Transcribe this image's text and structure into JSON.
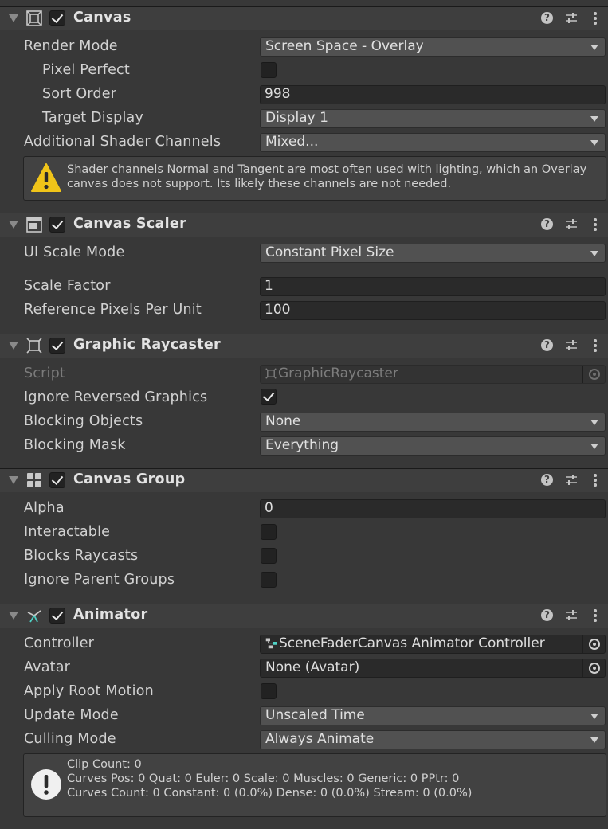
{
  "canvas": {
    "title": "Canvas",
    "enabled": true,
    "render_mode_label": "Render Mode",
    "render_mode_value": "Screen Space - Overlay",
    "pixel_perfect_label": "Pixel Perfect",
    "sort_order_label": "Sort Order",
    "sort_order_value": "998",
    "target_display_label": "Target Display",
    "target_display_value": "Display 1",
    "shader_channels_label": "Additional Shader Channels",
    "shader_channels_value": "Mixed...",
    "warning_line1": "Shader channels Normal and Tangent are most often used with lighting, which an Overlay",
    "warning_line2": "canvas does not support. Its likely these channels are not needed."
  },
  "canvas_scaler": {
    "title": "Canvas Scaler",
    "ui_scale_mode_label": "UI Scale Mode",
    "ui_scale_mode_value": "Constant Pixel Size",
    "scale_factor_label": "Scale Factor",
    "scale_factor_value": "1",
    "ref_ppu_label": "Reference Pixels Per Unit",
    "ref_ppu_value": "100"
  },
  "graphic_raycaster": {
    "title": "Graphic Raycaster",
    "script_label": "Script",
    "script_value": "GraphicRaycaster",
    "ignore_reversed_label": "Ignore Reversed Graphics",
    "blocking_objects_label": "Blocking Objects",
    "blocking_objects_value": "None",
    "blocking_mask_label": "Blocking Mask",
    "blocking_mask_value": "Everything"
  },
  "canvas_group": {
    "title": "Canvas Group",
    "alpha_label": "Alpha",
    "alpha_value": "0",
    "interactable_label": "Interactable",
    "blocks_raycasts_label": "Blocks Raycasts",
    "ignore_parent_label": "Ignore Parent Groups"
  },
  "animator": {
    "title": "Animator",
    "controller_label": "Controller",
    "controller_value": "SceneFaderCanvas Animator Controller",
    "avatar_label": "Avatar",
    "avatar_value": "None (Avatar)",
    "apply_root_motion_label": "Apply Root Motion",
    "update_mode_label": "Update Mode",
    "update_mode_value": "Unscaled Time",
    "culling_mode_label": "Culling Mode",
    "culling_mode_value": "Always Animate",
    "info_line1": "Clip Count: 0",
    "info_line2": "Curves Pos: 0 Quat: 0 Euler: 0 Scale: 0 Muscles: 0 Generic: 0 PPtr: 0",
    "info_line3": "Curves Count: 0 Constant: 0 (0.0%) Dense: 0 (0.0%) Stream: 0 (0.0%)"
  },
  "icons": {
    "help": "?",
    "colors": {
      "warning": "#f0c419",
      "info": "#f0f0f0",
      "animator_accent": "#4fd1c5"
    }
  }
}
